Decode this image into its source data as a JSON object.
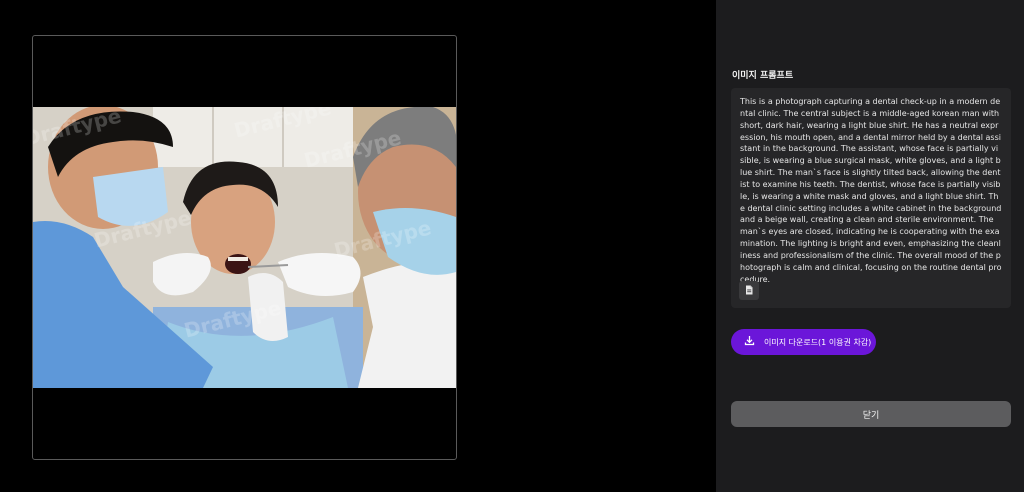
{
  "image_viewer": {
    "watermark_text": "Draftype"
  },
  "panel": {
    "prompt_heading": "이미지 프롬프트",
    "prompt_text": "This is a photograph capturing a dental check-up in a modern dental clinic. The central subject is a middle-aged korean man with short, dark hair, wearing a light blue shirt. He has a neutral expression, his mouth open, and a dental mirror held by a dental assistant in the background. The assistant, whose face is partially visible, is wearing a blue surgical mask, white gloves, and a light blue shirt. The man`s face is slightly tilted back, allowing the dentist to examine his teeth. The dentist, whose face is partially visible, is wearing a white mask and gloves, and a light blue shirt. The dental clinic setting includes a white cabinet in the background and a beige wall, creating a clean and sterile environment. The man`s eyes are closed, indicating he is cooperating with the examination. The lighting is bright and even, emphasizing the cleanliness and professionalism of the clinic. The overall mood of the photograph is calm and clinical, focusing on the routine dental procedure.",
    "copy_icon": "copy-icon",
    "download_label": "이미지 다운로드(1 이용권 차감)",
    "download_icon": "download-icon",
    "close_label": "닫기"
  },
  "colors": {
    "panel_bg": "#1c1c1e",
    "prompt_box_bg": "#262628",
    "accent": "#6b16d9",
    "close_button_bg": "#5c5c5e"
  }
}
